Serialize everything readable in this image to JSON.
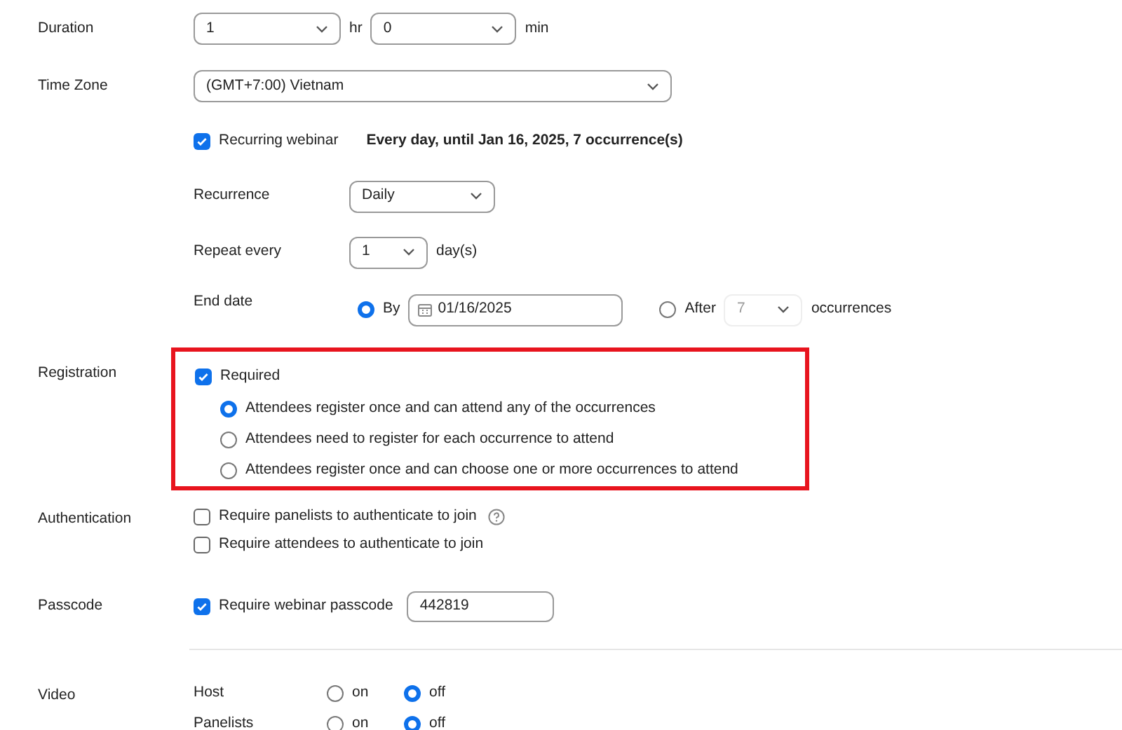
{
  "duration": {
    "label": "Duration",
    "hours": "1",
    "hours_unit": "hr",
    "minutes": "0",
    "minutes_unit": "min"
  },
  "time_zone": {
    "label": "Time Zone",
    "value": "(GMT+7:00) Vietnam"
  },
  "recurring": {
    "label": "Recurring webinar",
    "checked": true,
    "summary": "Every day, until Jan 16, 2025, 7 occurrence(s)",
    "recurrence": {
      "label": "Recurrence",
      "value": "Daily"
    },
    "repeat_every": {
      "label": "Repeat every",
      "value": "1",
      "unit": "day(s)"
    },
    "end_date": {
      "label": "End date",
      "options": [
        {
          "kind": "date",
          "label": "By",
          "selected": true,
          "value": "01/16/2025"
        },
        {
          "kind": "count",
          "label": "After",
          "selected": false,
          "value": "7",
          "unit": "occurrences",
          "disabled": true
        }
      ]
    }
  },
  "registration": {
    "label": "Registration",
    "highlighted": true,
    "required": {
      "label": "Required",
      "checked": true
    },
    "options": [
      {
        "label": "Attendees register once and can attend any of the occurrences",
        "selected": true
      },
      {
        "label": "Attendees need to register for each occurrence to attend",
        "selected": false
      },
      {
        "label": "Attendees register once and can choose one or more occurrences to attend",
        "selected": false
      }
    ]
  },
  "authentication": {
    "label": "Authentication",
    "options": [
      {
        "label": "Require panelists to authenticate to join",
        "checked": false,
        "help": true
      },
      {
        "label": "Require attendees to authenticate to join",
        "checked": false,
        "help": false
      }
    ]
  },
  "passcode": {
    "label": "Passcode",
    "option": {
      "label": "Require webinar passcode",
      "checked": true
    },
    "value": "442819"
  },
  "video": {
    "label": "Video",
    "rows": [
      {
        "label": "Host",
        "choices": [
          {
            "label": "on",
            "selected": false
          },
          {
            "label": "off",
            "selected": true
          }
        ]
      },
      {
        "label": "Panelists",
        "choices": [
          {
            "label": "on",
            "selected": false
          },
          {
            "label": "off",
            "selected": true
          }
        ]
      }
    ]
  }
}
